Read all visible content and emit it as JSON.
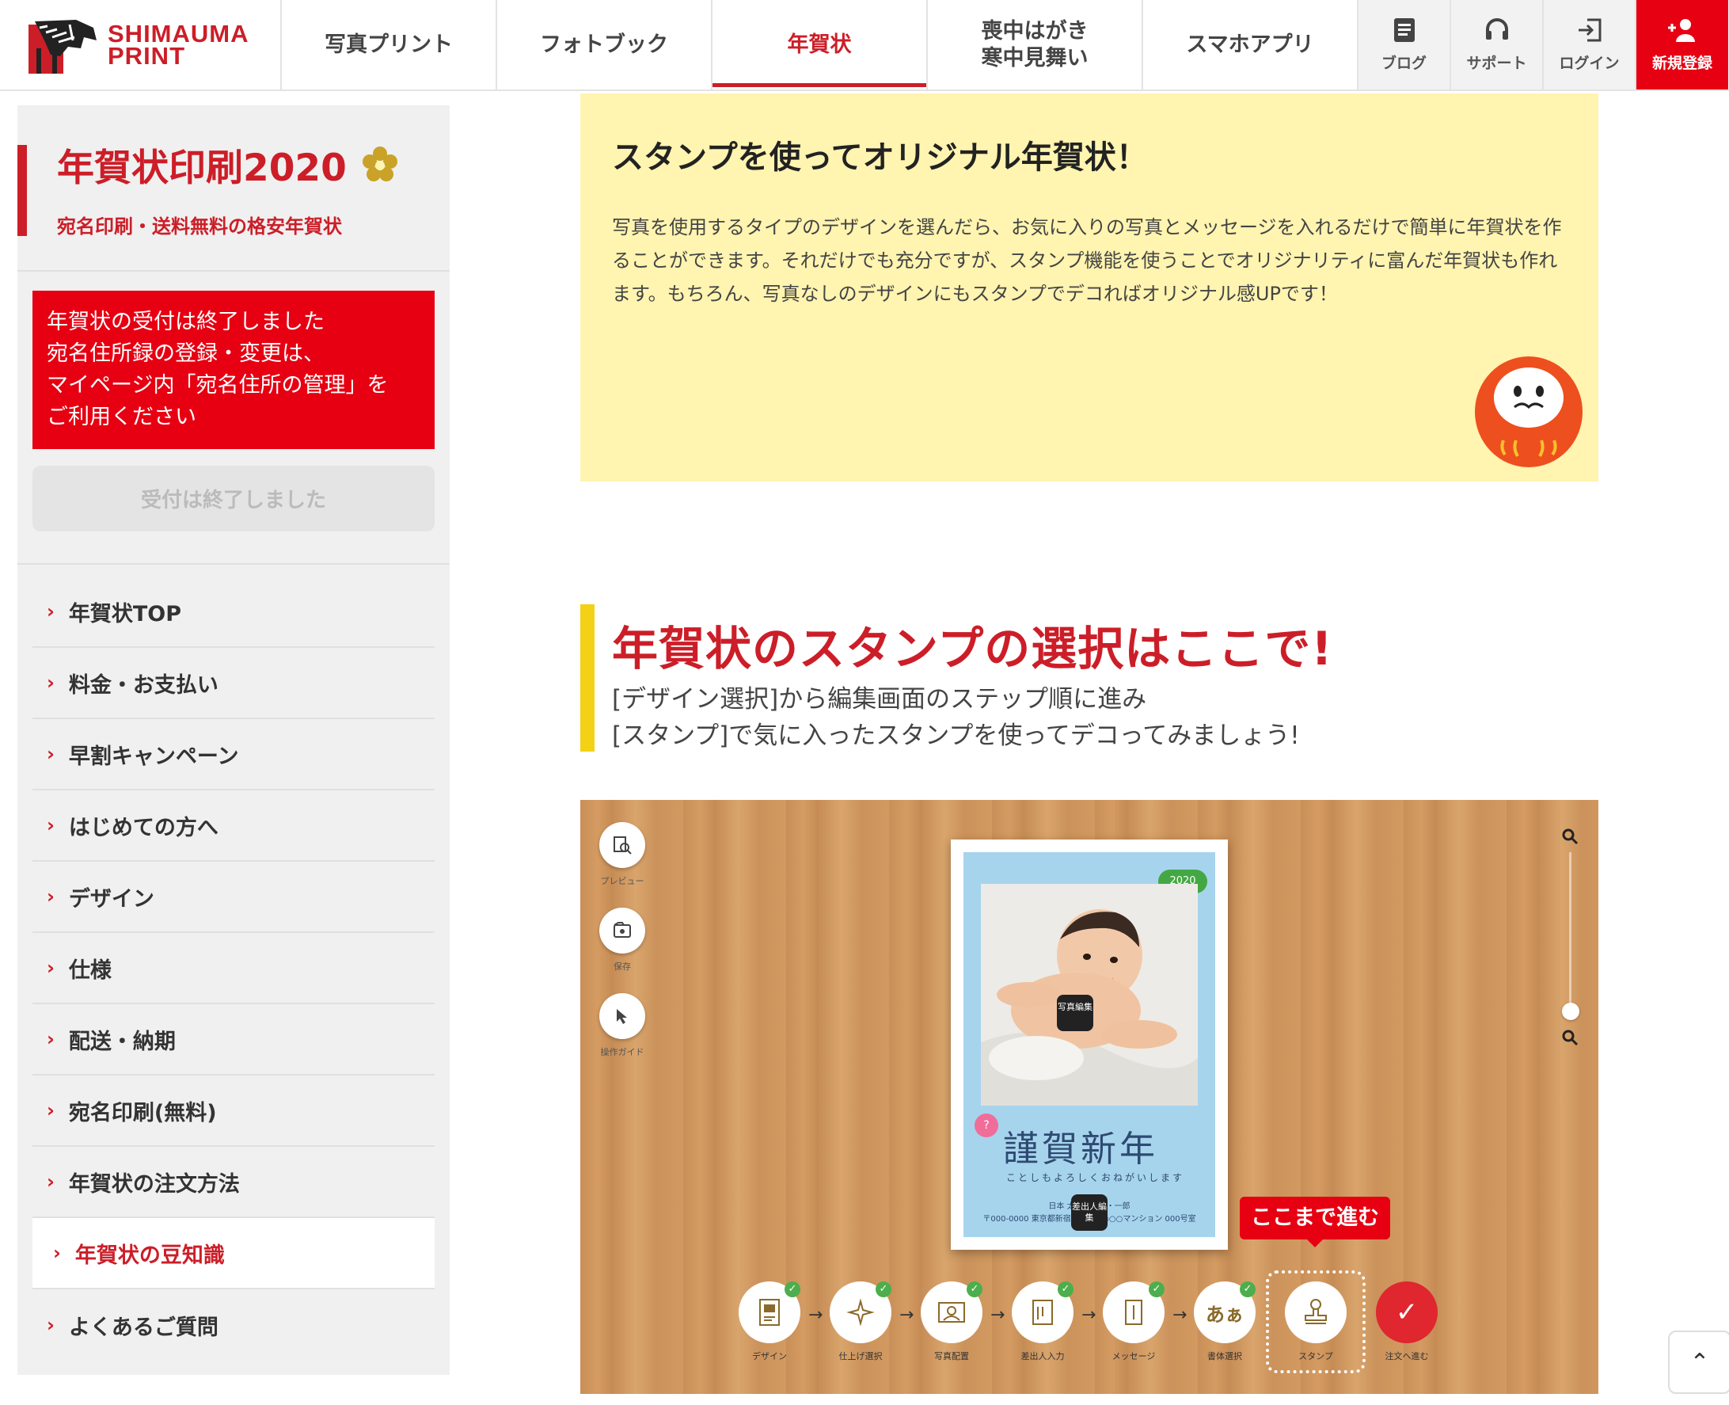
{
  "brand": {
    "line1": "SHIMAUMA",
    "line2": "PRINT"
  },
  "nav": {
    "items": [
      {
        "label": "写真プリント"
      },
      {
        "label": "フォトブック"
      },
      {
        "label": "年賀状"
      },
      {
        "label_line1": "喪中はがき",
        "label_line2": "寒中見舞い"
      },
      {
        "label": "スマホアプリ"
      }
    ],
    "active_index": 2,
    "utility": [
      {
        "label": "ブログ",
        "icon": "blog-icon"
      },
      {
        "label": "サポート",
        "icon": "headset-icon"
      },
      {
        "label": "ログイン",
        "icon": "login-icon"
      },
      {
        "label": "新規登録",
        "icon": "add-user-icon"
      }
    ]
  },
  "sidebar": {
    "title": "年賀状印刷2020",
    "subtitle": "宛名印刷・送料無料の格安年賀状",
    "notice": [
      "年賀状の受付は終了しました",
      "宛名住所録の登録・変更は、",
      "マイページ内「宛名住所の管理」を",
      "ご利用ください"
    ],
    "closed_button": "受付は終了しました",
    "menu": [
      "年賀状TOP",
      "料金・お支払い",
      "早割キャンペーン",
      "はじめての方へ",
      "デザイン",
      "仕様",
      "配送・納期",
      "宛名印刷(無料)",
      "年賀状の注文方法",
      "年賀状の豆知識",
      "よくあるご質問"
    ],
    "active_menu": "年賀状の豆知識"
  },
  "intro": {
    "title": "スタンプを使ってオリジナル年賀状！",
    "body": "写真を使用するタイプのデザインを選んだら、お気に入りの写真とメッセージを入れるだけで簡単に年賀状を作ることができます。それだけでも充分ですが、スタンプ機能を使うことでオリジナリティに富んだ年賀状も作れます。もちろん、写真なしのデザインにもスタンプでデコればオリジナル感UPです！"
  },
  "section": {
    "title": "年賀状のスタンプの選択はここで!",
    "desc_line1": "[デザイン選択]から編集画面のステップ順に進み",
    "desc_line2": "[スタンプ]で気に入ったスタンプを使ってデコってみましょう!"
  },
  "editor": {
    "tools": [
      {
        "label": "プレビュー",
        "icon": "preview-icon"
      },
      {
        "label": "保存",
        "icon": "save-icon"
      },
      {
        "label": "操作ガイド",
        "icon": "cursor-icon"
      }
    ],
    "card": {
      "year": "2020",
      "greeting": "謹賀新年",
      "greeting_sub": "ことしもよろしくおねがいします",
      "address": "日本 太郎・花子・一郎",
      "address_sub": "〒000-0000 東京都新宿区1-2-3 ○○○マンション 000号室",
      "photo_tag": "写真編集",
      "text_tag": "差出人編集",
      "pink_badge": "?"
    },
    "callout": "ここまで進む",
    "steps": [
      {
        "label": "デザイン",
        "icon": "design-icon",
        "done": true
      },
      {
        "label": "仕上げ選択",
        "icon": "sparkle-icon",
        "done": true
      },
      {
        "label": "写真配置",
        "icon": "photo-icon",
        "done": true
      },
      {
        "label": "差出人入力",
        "icon": "sender-icon",
        "done": true
      },
      {
        "label": "メッセージ",
        "icon": "message-icon",
        "done": true
      },
      {
        "label": "書体選択",
        "icon": "font-icon",
        "glyph": "あぁ",
        "done": true
      },
      {
        "label": "スタンプ",
        "icon": "stamp-icon",
        "done": false
      },
      {
        "label": "注文へ進む",
        "icon": "check-icon",
        "done": false
      }
    ],
    "current_step": "スタンプ"
  },
  "colors": {
    "brand_red": "#cc1e28",
    "notice_red": "#e60012",
    "intro_bg": "#fff4b0",
    "accent_yellow": "#f3d216"
  }
}
